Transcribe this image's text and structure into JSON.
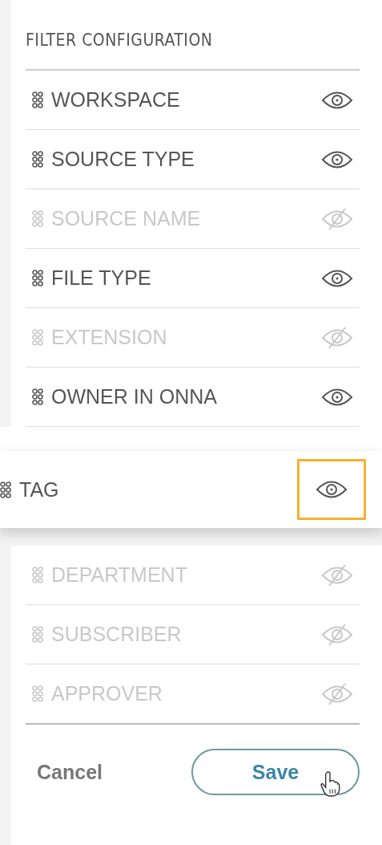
{
  "title": "FILTER CONFIGURATION",
  "fields": [
    {
      "kind": "field",
      "label": "WORKSPACE",
      "visible": true
    },
    {
      "kind": "field",
      "label": "SOURCE TYPE",
      "visible": true
    },
    {
      "kind": "field",
      "label": "SOURCE NAME",
      "visible": false
    },
    {
      "kind": "field",
      "label": "FILE TYPE",
      "visible": true
    },
    {
      "kind": "field",
      "label": "EXTENSION",
      "visible": false
    },
    {
      "kind": "field",
      "label": "OWNER IN ONNA",
      "visible": true
    },
    {
      "kind": "dragged",
      "label": "TAG",
      "visible": true,
      "highlighted": true
    },
    {
      "kind": "field",
      "label": "DEPARTMENT",
      "visible": false
    },
    {
      "kind": "field",
      "label": "SUBSCRIBER",
      "visible": false
    },
    {
      "kind": "field",
      "label": "APPROVER",
      "visible": false
    }
  ],
  "buttons": {
    "cancel": "Cancel",
    "save": "Save"
  }
}
